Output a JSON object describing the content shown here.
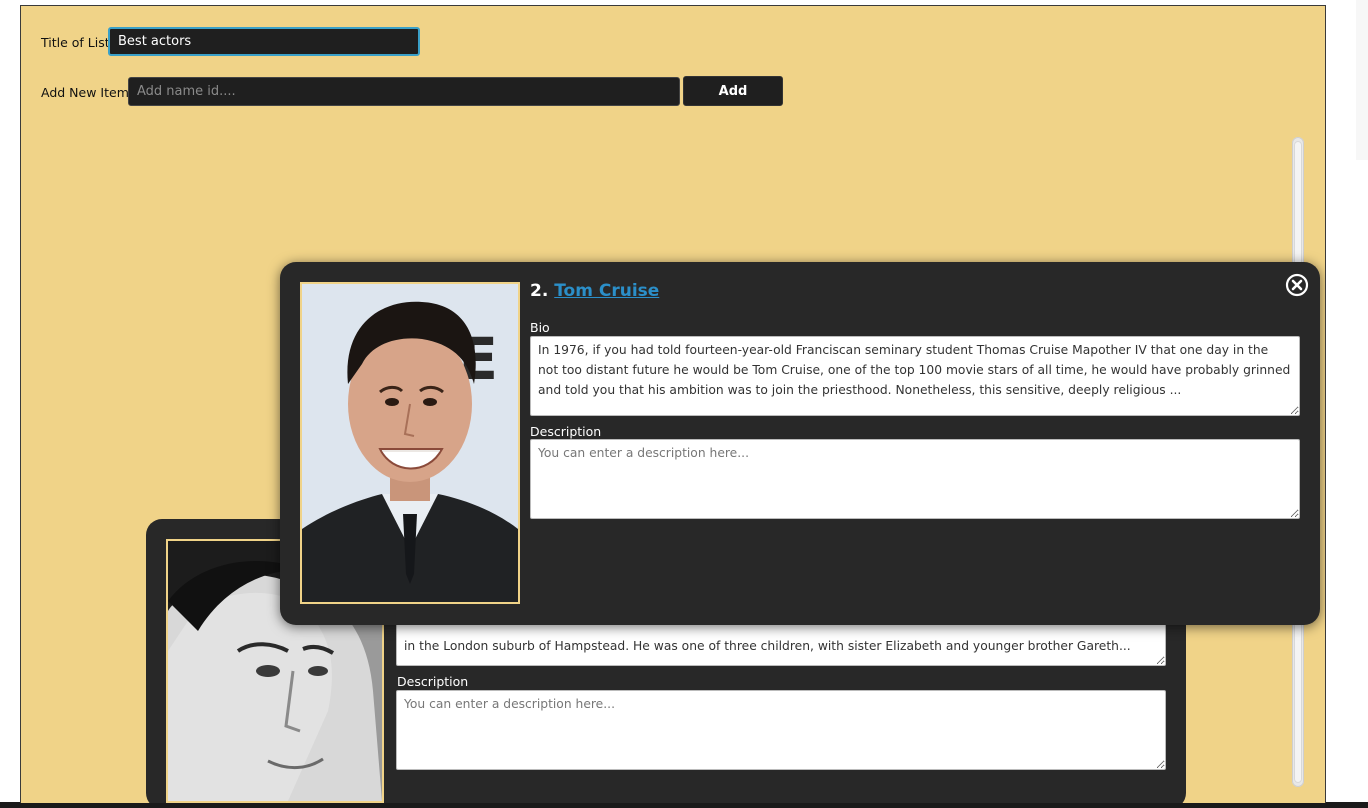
{
  "form": {
    "title_label": "Title of List",
    "title_value": "Best actors",
    "add_label": "Add New Item",
    "add_placeholder": "Add name id....",
    "add_button": "Add"
  },
  "cards": [
    {
      "rank": "2.",
      "name": "Tom Cruise",
      "bio_label": "Bio",
      "bio": "In 1976, if you had told fourteen-year-old Franciscan seminary student Thomas Cruise Mapother IV that one day in the not too distant future he would be Tom Cruise, one of the top 100 movie stars of all time, he would have probably grinned and told you that his ambition was to join the priesthood. Nonetheless, this sensitive, deeply religious ...",
      "description_label": "Description",
      "description_placeholder": "You can enter a description here..."
    },
    {
      "bio_visible": "in the London suburb of Hampstead. He was one of three children, with sister Elizabeth and younger brother Gareth...",
      "description_label": "Description",
      "description_placeholder": "You can enter a description here..."
    }
  ],
  "colors": {
    "background": "#f0d388",
    "card": "#282828",
    "input": "#1f1f1f",
    "link": "#2b8fc9",
    "focus": "#3aa0c8"
  },
  "icons": {
    "close": "close-circle-icon"
  }
}
